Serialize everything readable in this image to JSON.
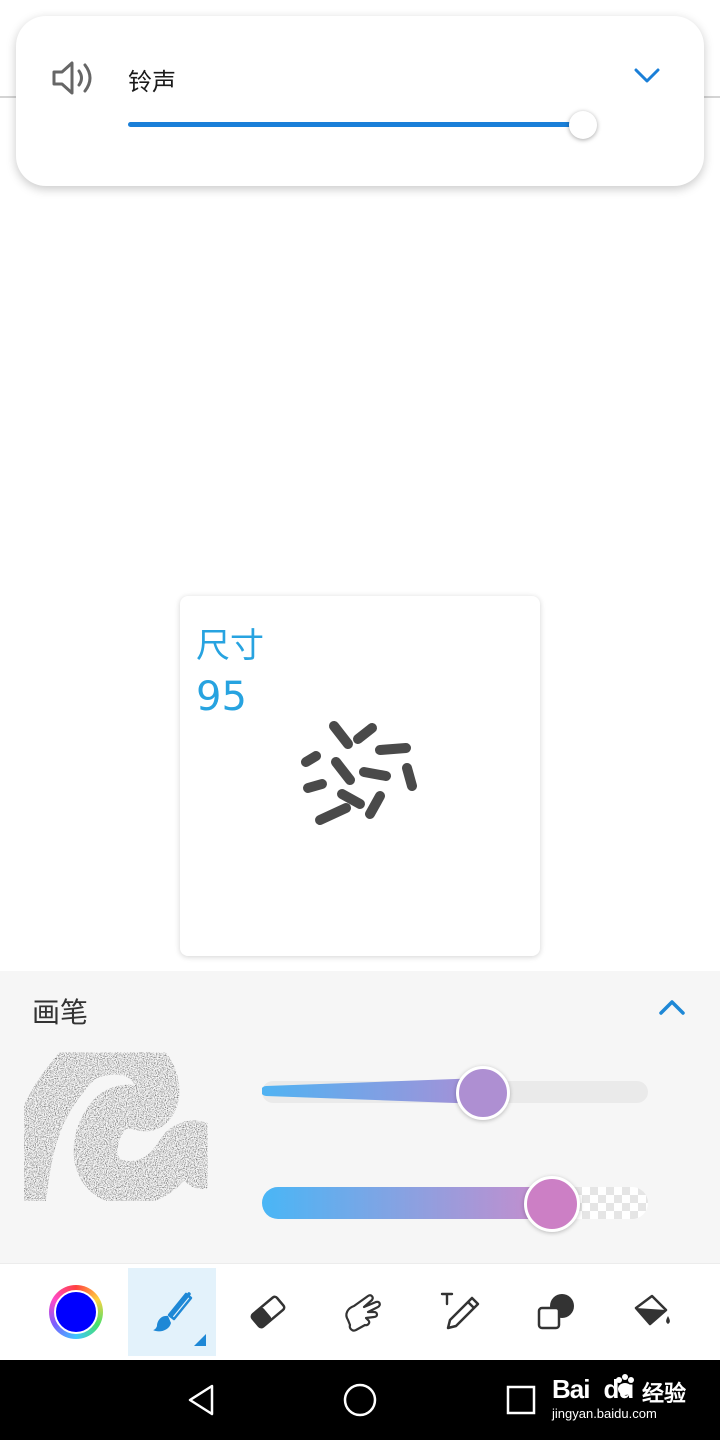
{
  "volume": {
    "label": "铃声",
    "level_fraction": 0.96,
    "accent_color": "#1a7fd8",
    "icon": "speaker-icon",
    "expand_icon": "chevron-down-icon"
  },
  "size_popup": {
    "title": "尺寸",
    "value": "95",
    "accent_color": "#27a3e0"
  },
  "brush_panel": {
    "title": "画笔",
    "collapse_icon": "chevron-up-icon",
    "size_slider_fraction": 0.57,
    "opacity_slider_fraction": 0.75
  },
  "toolbar": {
    "items": [
      {
        "name": "color-picker",
        "icon": "color-swatch",
        "color": "#0000ff"
      },
      {
        "name": "brush",
        "icon": "brush-icon",
        "active": true
      },
      {
        "name": "eraser",
        "icon": "eraser-icon"
      },
      {
        "name": "smudge",
        "icon": "finger-icon"
      },
      {
        "name": "text",
        "icon": "text-pen-icon"
      },
      {
        "name": "shapes",
        "icon": "shapes-icon"
      },
      {
        "name": "fill",
        "icon": "paint-bucket-icon"
      }
    ]
  },
  "navbar": {
    "buttons": [
      "back-icon",
      "home-icon",
      "recents-icon"
    ],
    "watermark_brand": "Bai",
    "watermark_brand_tail": "du",
    "watermark_cn": "经验",
    "watermark_url": "jingyan.baidu.com"
  }
}
